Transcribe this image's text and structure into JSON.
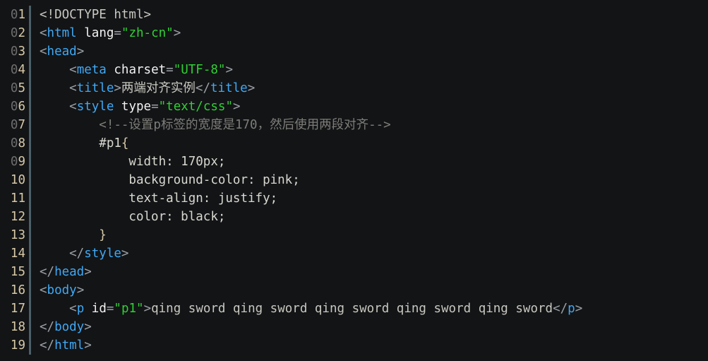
{
  "editor": {
    "name": "code-listing",
    "language": "html",
    "background_color": "#131416",
    "gutter_color": "#d7c9a7",
    "separator_color": "#4a6069",
    "total_lines": 19
  },
  "colors": {
    "punctuation": "#9aa0a6",
    "tag": "#3fa9f5",
    "attribute": "#f2f2f2",
    "string": "#2fd034",
    "plain": "#c8c8c0",
    "comment": "#7d7d78",
    "brace": "#d7c9a7"
  },
  "lines": [
    {
      "number": "01",
      "tokens": [
        {
          "text": "<!DOCTYPE html>",
          "type": "doctype"
        }
      ]
    },
    {
      "number": "02",
      "tokens": [
        {
          "text": "<",
          "type": "punct"
        },
        {
          "text": "html",
          "type": "tag"
        },
        {
          "text": " ",
          "type": "plain"
        },
        {
          "text": "lang",
          "type": "attr"
        },
        {
          "text": "=",
          "type": "punct"
        },
        {
          "text": "\"zh-cn\"",
          "type": "string"
        },
        {
          "text": ">",
          "type": "punct"
        }
      ]
    },
    {
      "number": "03",
      "tokens": [
        {
          "text": "<",
          "type": "punct"
        },
        {
          "text": "head",
          "type": "tag"
        },
        {
          "text": ">",
          "type": "punct"
        }
      ]
    },
    {
      "number": "04",
      "tokens": [
        {
          "text": "    <",
          "type": "punct"
        },
        {
          "text": "meta",
          "type": "tag"
        },
        {
          "text": " ",
          "type": "plain"
        },
        {
          "text": "charset",
          "type": "attr"
        },
        {
          "text": "=",
          "type": "punct"
        },
        {
          "text": "\"UTF-8\"",
          "type": "string"
        },
        {
          "text": ">",
          "type": "punct"
        }
      ]
    },
    {
      "number": "05",
      "tokens": [
        {
          "text": "    <",
          "type": "punct"
        },
        {
          "text": "title",
          "type": "tag"
        },
        {
          "text": ">",
          "type": "punct"
        },
        {
          "text": "两端对齐实例",
          "type": "content"
        },
        {
          "text": "</",
          "type": "punct"
        },
        {
          "text": "title",
          "type": "tag"
        },
        {
          "text": ">",
          "type": "punct"
        }
      ]
    },
    {
      "number": "06",
      "tokens": [
        {
          "text": "    <",
          "type": "punct"
        },
        {
          "text": "style",
          "type": "tag"
        },
        {
          "text": " ",
          "type": "plain"
        },
        {
          "text": "type",
          "type": "attr"
        },
        {
          "text": "=",
          "type": "punct"
        },
        {
          "text": "\"text/css\"",
          "type": "string"
        },
        {
          "text": ">",
          "type": "punct"
        }
      ]
    },
    {
      "number": "07",
      "tokens": [
        {
          "text": "        <!--设置p标签的宽度是170，然后使用两段对齐-->",
          "type": "comment"
        }
      ]
    },
    {
      "number": "08",
      "tokens": [
        {
          "text": "        #p1",
          "type": "css"
        },
        {
          "text": "{",
          "type": "brace"
        }
      ]
    },
    {
      "number": "09",
      "tokens": [
        {
          "text": "            width: 170px;",
          "type": "css"
        }
      ]
    },
    {
      "number": "10",
      "tokens": [
        {
          "text": "            background-color: pink;",
          "type": "css"
        }
      ]
    },
    {
      "number": "11",
      "tokens": [
        {
          "text": "            text-align: justify;",
          "type": "css"
        }
      ]
    },
    {
      "number": "12",
      "tokens": [
        {
          "text": "            color: black;",
          "type": "css"
        }
      ]
    },
    {
      "number": "13",
      "tokens": [
        {
          "text": "        ",
          "type": "css"
        },
        {
          "text": "}",
          "type": "brace"
        }
      ]
    },
    {
      "number": "14",
      "tokens": [
        {
          "text": "    </",
          "type": "punct"
        },
        {
          "text": "style",
          "type": "tag"
        },
        {
          "text": ">",
          "type": "punct"
        }
      ]
    },
    {
      "number": "15",
      "tokens": [
        {
          "text": "</",
          "type": "punct"
        },
        {
          "text": "head",
          "type": "tag"
        },
        {
          "text": ">",
          "type": "punct"
        }
      ]
    },
    {
      "number": "16",
      "tokens": [
        {
          "text": "<",
          "type": "punct"
        },
        {
          "text": "body",
          "type": "tag"
        },
        {
          "text": ">",
          "type": "punct"
        }
      ]
    },
    {
      "number": "17",
      "tokens": [
        {
          "text": "    <",
          "type": "punct"
        },
        {
          "text": "p",
          "type": "tag"
        },
        {
          "text": " ",
          "type": "plain"
        },
        {
          "text": "id",
          "type": "attr"
        },
        {
          "text": "=",
          "type": "punct"
        },
        {
          "text": "\"p1\"",
          "type": "string"
        },
        {
          "text": ">",
          "type": "punct"
        },
        {
          "text": "qing sword qing sword qing sword qing sword qing sword",
          "type": "content"
        },
        {
          "text": "</",
          "type": "punct"
        },
        {
          "text": "p",
          "type": "tag"
        },
        {
          "text": ">",
          "type": "punct"
        }
      ]
    },
    {
      "number": "18",
      "tokens": [
        {
          "text": "</",
          "type": "punct"
        },
        {
          "text": "body",
          "type": "tag"
        },
        {
          "text": ">",
          "type": "punct"
        }
      ]
    },
    {
      "number": "19",
      "tokens": [
        {
          "text": "</",
          "type": "punct"
        },
        {
          "text": "html",
          "type": "tag"
        },
        {
          "text": ">",
          "type": "punct"
        }
      ]
    }
  ]
}
